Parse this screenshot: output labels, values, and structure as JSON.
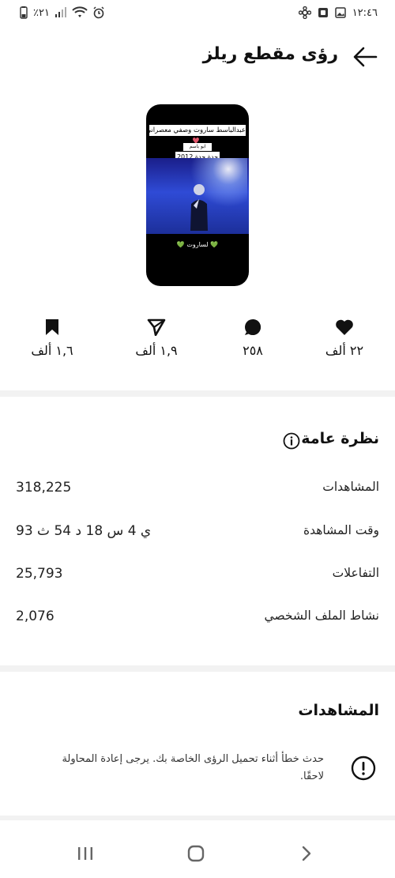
{
  "status_bar": {
    "time": "١٢:٤٦",
    "battery": "٪٢١"
  },
  "header": {
    "title": "رؤى مقطع ريلز"
  },
  "thumbnail": {
    "caption_top": "عبدالباسط ساروت وصفي معصراني",
    "caption_sub": "ابو باسم",
    "caption_year": "جدة جدة 2012",
    "caption_bottom": "💚 لساروت 💚"
  },
  "stats": {
    "likes": "٢٢ ألف",
    "comments": "٢٥٨",
    "shares": "١,٩ ألف",
    "saves": "١,٦ ألف"
  },
  "overview": {
    "title": "نظرة عامة",
    "rows": [
      {
        "label": "المشاهدات",
        "value": "318,225"
      },
      {
        "label": "وقت المشاهدة",
        "value": "93 ي 4 س 18 د 54 ث"
      },
      {
        "label": "التفاعلات",
        "value": "25,793"
      },
      {
        "label": "نشاط الملف الشخصي",
        "value": "2,076"
      }
    ]
  },
  "views_section": {
    "title": "المشاهدات",
    "error": "حدث خطأ أثناء تحميل الرؤى الخاصة بك. يرجى إعادة المحاولة لاحقًا."
  },
  "icons": {
    "back": "arrow-left-icon",
    "info": "info-icon",
    "error": "exclamation-circle-icon",
    "like": "heart-icon",
    "comment": "comment-icon",
    "share": "send-icon",
    "save": "bookmark-icon"
  }
}
